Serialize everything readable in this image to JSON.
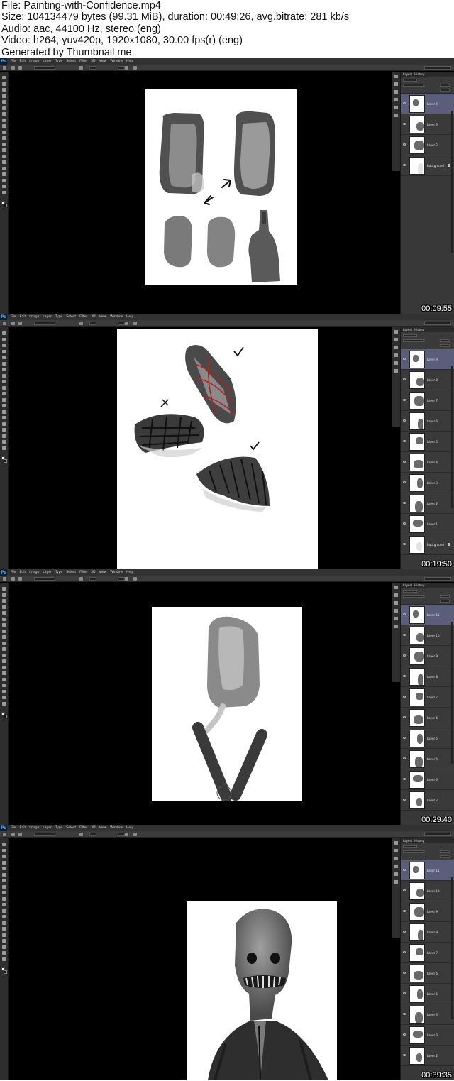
{
  "header": {
    "file_line": "File: Painting-with-Confidence.mp4",
    "size_line": "Size: 104134479 bytes (99.31 MiB), duration: 00:49:26, avg.bitrate: 281 kb/s",
    "audio_line": "Audio: aac, 44100 Hz, stereo (eng)",
    "video_line": "Video: h264, yuv420p, 1920x1080, 30.00 fps(r) (eng)",
    "generated_line": "Generated by Thumbnail me"
  },
  "app": {
    "logo": "Ps",
    "menu": [
      "File",
      "Edit",
      "Image",
      "Layer",
      "Type",
      "Select",
      "Filter",
      "3D",
      "View",
      "Window",
      "Help"
    ]
  },
  "panels": {
    "layers_tab": "Layers",
    "history_tab": "History"
  },
  "frames": [
    {
      "timestamp": "00:09:55",
      "layers": [
        {
          "name": "Layer 4",
          "selected": true
        },
        {
          "name": "Layer 3",
          "selected": false
        },
        {
          "name": "Layer 2",
          "selected": false
        },
        {
          "name": "Background",
          "selected": false,
          "locked": true
        }
      ]
    },
    {
      "timestamp": "00:19:50",
      "layers": [
        {
          "name": "Layer 9",
          "selected": true
        },
        {
          "name": "Layer 8",
          "selected": false
        },
        {
          "name": "Layer 7",
          "selected": false
        },
        {
          "name": "Layer 6",
          "selected": false
        },
        {
          "name": "Layer 5",
          "selected": false
        },
        {
          "name": "Layer 4",
          "selected": false
        },
        {
          "name": "Layer 3",
          "selected": false
        },
        {
          "name": "Layer 2",
          "selected": false
        },
        {
          "name": "Layer 1",
          "selected": false
        },
        {
          "name": "Background",
          "selected": false,
          "locked": true
        }
      ]
    },
    {
      "timestamp": "00:29:40",
      "layers": [
        {
          "name": "Layer 11",
          "selected": true
        },
        {
          "name": "Layer 10",
          "selected": false
        },
        {
          "name": "Layer 9",
          "selected": false
        },
        {
          "name": "Layer 8",
          "selected": false
        },
        {
          "name": "Layer 7",
          "selected": false
        },
        {
          "name": "Layer 6",
          "selected": false
        },
        {
          "name": "Layer 5",
          "selected": false
        },
        {
          "name": "Layer 4",
          "selected": false
        },
        {
          "name": "Layer 3",
          "selected": false
        },
        {
          "name": "Layer 2",
          "selected": false
        }
      ]
    },
    {
      "timestamp": "00:39:35",
      "layers": [
        {
          "name": "Layer 11",
          "selected": true
        },
        {
          "name": "Layer 10",
          "selected": false
        },
        {
          "name": "Layer 9",
          "selected": false
        },
        {
          "name": "Layer 8",
          "selected": false
        },
        {
          "name": "Layer 7",
          "selected": false
        },
        {
          "name": "Layer 6",
          "selected": false
        },
        {
          "name": "Layer 5",
          "selected": false
        },
        {
          "name": "Layer 4",
          "selected": false
        },
        {
          "name": "Layer 3",
          "selected": false
        },
        {
          "name": "Layer 2",
          "selected": false
        }
      ]
    }
  ]
}
